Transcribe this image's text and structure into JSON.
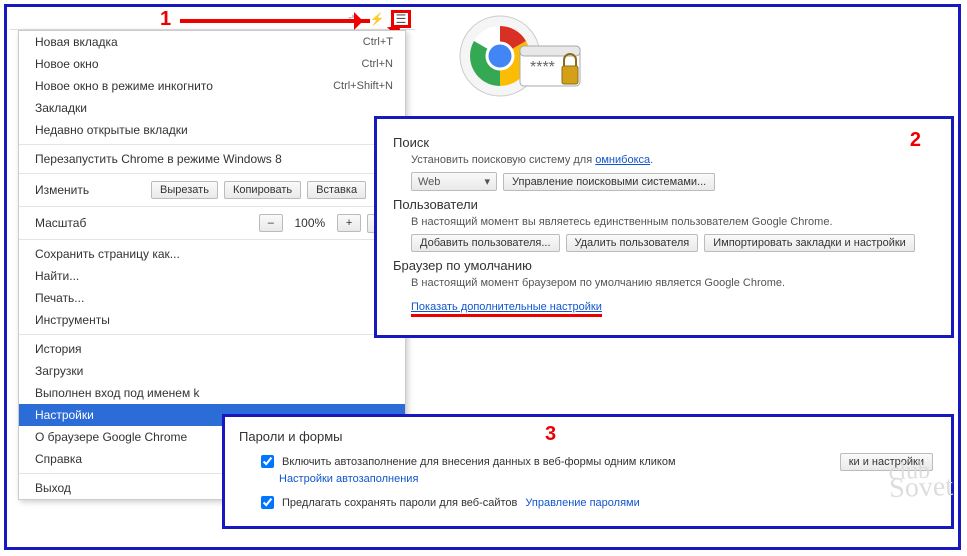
{
  "annotations": {
    "n1": "1",
    "n2": "2",
    "n3": "3"
  },
  "toolbar": {
    "star": "☆",
    "bolt": "⚡",
    "menu": "☰"
  },
  "menu": {
    "new_tab": "Новая вкладка",
    "new_tab_sc": "Ctrl+T",
    "new_window": "Новое окно",
    "new_window_sc": "Ctrl+N",
    "incognito": "Новое окно в режиме инкогнито",
    "incognito_sc": "Ctrl+Shift+N",
    "bookmarks": "Закладки",
    "recent": "Недавно открытые вкладки",
    "relaunch": "Перезапустить Chrome в режиме Windows 8",
    "edit": "Изменить",
    "cut": "Вырезать",
    "copy": "Копировать",
    "paste": "Вставка",
    "zoom": "Масштаб",
    "zminus": "–",
    "zval": "100%",
    "zplus": "+",
    "zfull": "⛶",
    "save_page": "Сохранить страницу как...",
    "find": "Найти...",
    "print": "Печать...",
    "tools": "Инструменты",
    "history": "История",
    "downloads": "Загрузки",
    "signed_in": "Выполнен вход под именем k",
    "settings": "Настройки",
    "about": "О браузере Google Chrome",
    "help": "Справка",
    "exit": "Выход"
  },
  "settings": {
    "search_h": "Поиск",
    "search_text_pre": "Установить поисковую систему для ",
    "search_text_link": "омнибокса",
    "search_text_post": ".",
    "engine_sel": "Web",
    "manage_engines": "Управление поисковыми системами...",
    "users_h": "Пользователи",
    "users_text": "В настоящий момент вы являетесь единственным пользователем Google Chrome.",
    "add_user": "Добавить пользователя...",
    "del_user": "Удалить пользователя",
    "import": "Импортировать закладки и настройки",
    "default_h": "Браузер по умолчанию",
    "default_text": "В настоящий момент браузером по умолчанию является Google Chrome.",
    "advanced": "Показать дополнительные настройки"
  },
  "pass": {
    "heading": "Пароли и формы",
    "autofill": "Включить автозаполнение для внесения данных в веб-формы одним кликом",
    "autofill_link": "Настройки автозаполнения",
    "offer": "Предлагать сохранять пароли для веб-сайтов",
    "manage": "Управление паролями",
    "over_btn": "ки и настройки"
  },
  "watermark": {
    "l1": "club",
    "l2": "Sovet"
  }
}
